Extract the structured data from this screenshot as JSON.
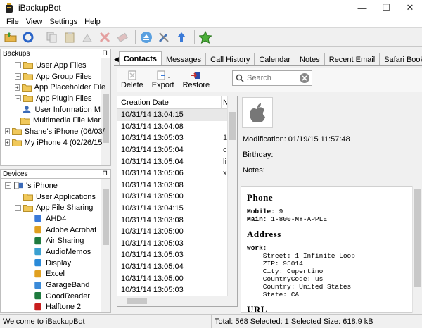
{
  "window": {
    "title": "iBackupBot",
    "minimize": "—",
    "maximize": "☐",
    "close": "✕"
  },
  "menu": [
    "File",
    "View",
    "Settings",
    "Help"
  ],
  "toolbar": {
    "icons": [
      "open-folder-icon",
      "refresh-icon",
      "copy-icon",
      "paste-icon",
      "clean-icon",
      "delete-icon",
      "eraser-icon",
      "eject-icon",
      "tools-icon",
      "upload-icon",
      "star-icon"
    ]
  },
  "backups_panel": {
    "title": "Backups",
    "pin": "⊓",
    "items": [
      {
        "label": "User App Files",
        "level": 2,
        "icon": "folder-icon",
        "expander": "+"
      },
      {
        "label": "App Group Files",
        "level": 2,
        "icon": "folder-icon",
        "expander": "+"
      },
      {
        "label": "App Placeholder File",
        "level": 2,
        "icon": "folder-icon",
        "expander": "+"
      },
      {
        "label": "App Plugin Files",
        "level": 2,
        "icon": "folder-icon",
        "expander": "+"
      },
      {
        "label": "User Information M",
        "level": 2,
        "icon": "user-icon",
        "expander": ""
      },
      {
        "label": "Multimedia File Mar",
        "level": 2,
        "icon": "folder-icon",
        "expander": ""
      },
      {
        "label": "Shane's iPhone (06/03/",
        "level": 1,
        "icon": "folder-icon",
        "expander": "+"
      },
      {
        "label": "My iPhone 4 (02/26/15",
        "level": 1,
        "icon": "folder-icon",
        "expander": "+"
      }
    ]
  },
  "devices_panel": {
    "title": "Devices",
    "pin": "⊓",
    "items": [
      {
        "label": "'s iPhone",
        "level": 1,
        "icon": "device-icon",
        "expander": "−"
      },
      {
        "label": "User Applications",
        "level": 2,
        "icon": "folder-icon",
        "expander": ""
      },
      {
        "label": "App File Sharing",
        "level": 2,
        "icon": "folder-icon",
        "expander": "−"
      },
      {
        "label": "AHD4",
        "level": 3,
        "icon": "app-icon",
        "expander": ""
      },
      {
        "label": "Adobe Acrobat",
        "level": 3,
        "icon": "app-icon",
        "expander": ""
      },
      {
        "label": "Air Sharing",
        "level": 3,
        "icon": "app-icon",
        "expander": ""
      },
      {
        "label": "AudioMemos",
        "level": 3,
        "icon": "app-icon",
        "expander": ""
      },
      {
        "label": "Display",
        "level": 3,
        "icon": "app-icon",
        "expander": ""
      },
      {
        "label": "Excel",
        "level": 3,
        "icon": "app-icon",
        "expander": ""
      },
      {
        "label": "GarageBand",
        "level": 3,
        "icon": "app-icon",
        "expander": ""
      },
      {
        "label": "GoodReader",
        "level": 3,
        "icon": "app-icon",
        "expander": ""
      },
      {
        "label": "Halftone 2",
        "level": 3,
        "icon": "app-icon",
        "expander": ""
      }
    ]
  },
  "tabs": [
    "Contacts",
    "Messages",
    "Call History",
    "Calendar",
    "Notes",
    "Recent Email",
    "Safari Bookma"
  ],
  "active_tab": 0,
  "subtoolbar": {
    "delete_label": "Delete",
    "export_label": "Export",
    "restore_label": "Restore",
    "search_placeholder": "Search"
  },
  "list": {
    "col1": "Creation Date",
    "col2": "N",
    "rows": [
      {
        "date": "10/31/14 13:04:15",
        "n": ""
      },
      {
        "date": "10/31/14 13:04:08",
        "n": ""
      },
      {
        "date": "10/31/14 13:05:03",
        "n": "1"
      },
      {
        "date": "10/31/14 13:05:04",
        "n": "c"
      },
      {
        "date": "10/31/14 13:05:04",
        "n": "li"
      },
      {
        "date": "10/31/14 13:05:06",
        "n": "x"
      },
      {
        "date": "10/31/14 13:03:08",
        "n": ""
      },
      {
        "date": "10/31/14 13:05:00",
        "n": ""
      },
      {
        "date": "10/31/14 13:04:15",
        "n": ""
      },
      {
        "date": "10/31/14 13:03:08",
        "n": ""
      },
      {
        "date": "10/31/14 13:05:00",
        "n": ""
      },
      {
        "date": "10/31/14 13:05:03",
        "n": ""
      },
      {
        "date": "10/31/14 13:05:03",
        "n": ""
      },
      {
        "date": "10/31/14 13:05:04",
        "n": ""
      },
      {
        "date": "10/31/14 13:05:00",
        "n": ""
      },
      {
        "date": "10/31/14 13:05:03",
        "n": ""
      }
    ]
  },
  "detail": {
    "modification_label": "Modification: 01/19/15 11:57:48",
    "birthday_label": "Birthday:",
    "notes_label": "Notes:"
  },
  "vcard": {
    "phone_heading": "Phone",
    "mobile_key": "Mobile",
    "mobile_value": ": 9",
    "main_key": "Main",
    "main_value": ": 1-800-MY-APPLE",
    "address_heading": "Address",
    "work_key": "Work",
    "work_value": ":",
    "street": "    Street: 1 Infinite Loop",
    "zip": "    ZIP: 95014",
    "city": "    City: Cupertino",
    "countrycode": "    CountryCode: us",
    "country": "    Country: United States",
    "state": "    State: CA",
    "url_heading": "URL"
  },
  "status": {
    "left": "Welcome to iBackupBot",
    "right": "Total: 568 Selected: 1 Selected Size: 618.9 kB"
  }
}
